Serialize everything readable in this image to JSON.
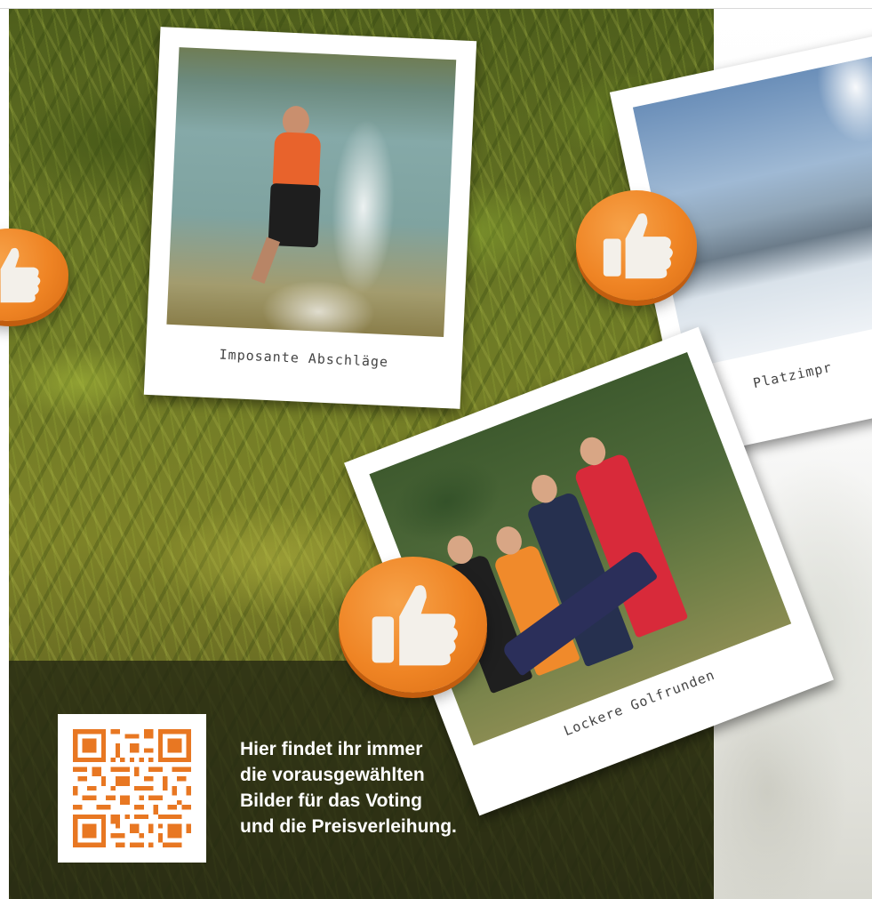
{
  "photos": [
    {
      "caption": "Imposante Abschläge"
    },
    {
      "caption": "Platzimpr"
    },
    {
      "caption": "Lockere Golfrunden"
    }
  ],
  "info": {
    "lines": [
      "Hier findet ihr immer",
      "die vorausgewählten",
      "Bilder für das Voting",
      "und die Preisverleihung."
    ]
  },
  "colors": {
    "accent": "#ef8424",
    "qr": "#e87722",
    "text_light": "#ffffff"
  },
  "icons": [
    "thumbs-up-icon",
    "qr-code-icon"
  ]
}
